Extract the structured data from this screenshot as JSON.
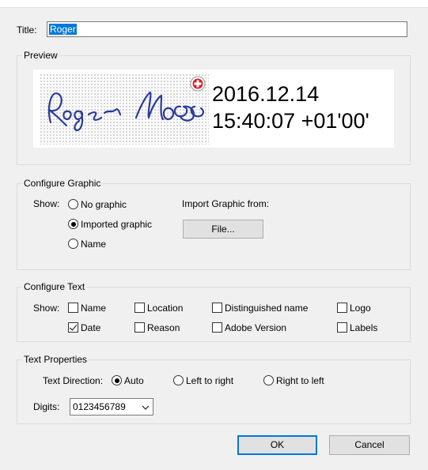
{
  "title_field": {
    "label": "Title:",
    "value": "Roger"
  },
  "preview": {
    "legend": "Preview",
    "line1": "2016.12.14",
    "line2": "15:40:07 +01'00'"
  },
  "configure_graphic": {
    "legend": "Configure Graphic",
    "show_label": "Show:",
    "options": [
      "No graphic",
      "Imported graphic",
      "Name"
    ],
    "selected": "Imported graphic",
    "import_label": "Import Graphic from:",
    "file_button": "File..."
  },
  "configure_text": {
    "legend": "Configure Text",
    "show_label": "Show:",
    "items": [
      {
        "label": "Name",
        "checked": false
      },
      {
        "label": "Location",
        "checked": false
      },
      {
        "label": "Distinguished name",
        "checked": false
      },
      {
        "label": "Logo",
        "checked": false
      },
      {
        "label": "Date",
        "checked": true
      },
      {
        "label": "Reason",
        "checked": false
      },
      {
        "label": "Adobe Version",
        "checked": false
      },
      {
        "label": "Labels",
        "checked": false
      }
    ]
  },
  "text_properties": {
    "legend": "Text Properties",
    "direction_label": "Text Direction:",
    "directions": [
      "Auto",
      "Left to right",
      "Right to left"
    ],
    "selected_direction": "Auto",
    "digits_label": "Digits:",
    "digits_value": "0123456789"
  },
  "buttons": {
    "ok": "OK",
    "cancel": "Cancel"
  },
  "colors": {
    "accent": "#0078d7",
    "ink": "#2b3a9c",
    "badge": "#d4202a"
  }
}
